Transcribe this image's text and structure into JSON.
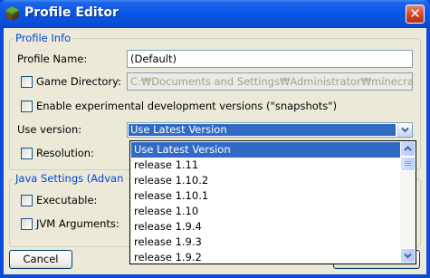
{
  "window": {
    "title": "Profile Editor",
    "close_glyph": "✕"
  },
  "profile_info": {
    "group_title": "Profile Info",
    "profile_name_label": "Profile Name:",
    "profile_name_value": "(Default)",
    "game_directory_label": "Game Directory:",
    "game_directory_value": "C:₩Documents and Settings₩Administrator₩minecraft",
    "snapshots_label": "Enable experimental development versions (\"snapshots\")",
    "use_version_label": "Use version:",
    "use_version_value": "Use Latest Version",
    "resolution_label": "Resolution:"
  },
  "java_settings": {
    "group_title": "Java Settings (Advan",
    "executable_label": "Executable:",
    "jvm_arguments_label": "JVM Arguments:"
  },
  "version_dropdown": {
    "options": [
      "Use Latest Version",
      "release 1.11",
      "release 1.10.2",
      "release 1.10.1",
      "release 1.10",
      "release 1.9.4",
      "release 1.9.3",
      "release 1.9.2"
    ],
    "selected_index": 0
  },
  "footer": {
    "cancel_label": "Cancel"
  },
  "colors": {
    "selection": "#316ac5",
    "group_title": "#0046d5",
    "titlebar": "#0955e5"
  },
  "icons": {
    "app": "minecraft-grass-block-icon"
  }
}
